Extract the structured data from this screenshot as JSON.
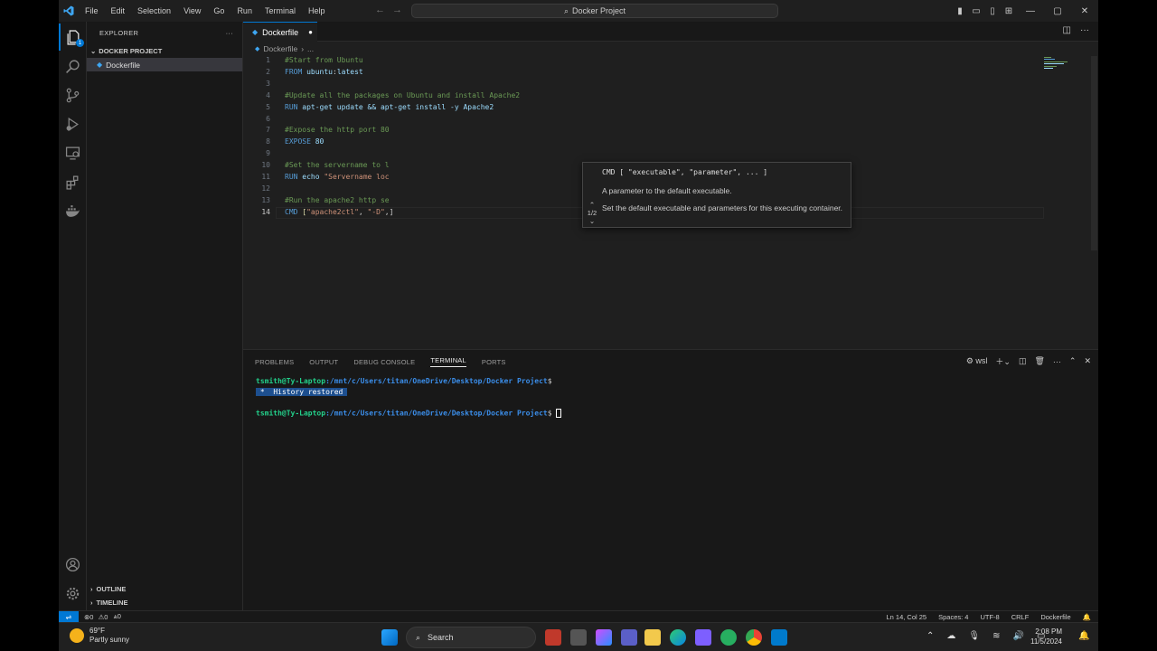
{
  "menu": [
    "File",
    "Edit",
    "Selection",
    "View",
    "Go",
    "Run",
    "Terminal",
    "Help"
  ],
  "command_center": "Docker Project",
  "sidebar": {
    "header": "EXPLORER",
    "project": "DOCKER PROJECT",
    "file": "Dockerfile",
    "outline": "OUTLINE",
    "timeline": "TIMELINE"
  },
  "editor": {
    "tab": "Dockerfile",
    "breadcrumb_file": "Dockerfile",
    "breadcrumb_more": "...",
    "lines": [
      {
        "n": "1",
        "parts": [
          {
            "c": "cm",
            "t": "#Start from Ubuntu"
          }
        ]
      },
      {
        "n": "2",
        "parts": [
          {
            "c": "kw",
            "t": "FROM "
          },
          {
            "c": "var",
            "t": "ubuntu"
          },
          {
            "c": "",
            "t": ":"
          },
          {
            "c": "var",
            "t": "latest"
          }
        ]
      },
      {
        "n": "3",
        "parts": []
      },
      {
        "n": "4",
        "parts": [
          {
            "c": "cm",
            "t": "#Update all the packages on Ubuntu and install Apache2"
          }
        ]
      },
      {
        "n": "5",
        "parts": [
          {
            "c": "kw",
            "t": "RUN "
          },
          {
            "c": "var",
            "t": "apt-get update && apt-get install -y Apache2"
          }
        ]
      },
      {
        "n": "6",
        "parts": []
      },
      {
        "n": "7",
        "parts": [
          {
            "c": "cm",
            "t": "#Expose the http port 80"
          }
        ]
      },
      {
        "n": "8",
        "parts": [
          {
            "c": "kw",
            "t": "EXPOSE "
          },
          {
            "c": "var",
            "t": "80"
          }
        ]
      },
      {
        "n": "9",
        "parts": []
      },
      {
        "n": "10",
        "parts": [
          {
            "c": "cm",
            "t": "#Set the servername to l"
          }
        ]
      },
      {
        "n": "11",
        "parts": [
          {
            "c": "kw",
            "t": "RUN "
          },
          {
            "c": "var",
            "t": "echo "
          },
          {
            "c": "str",
            "t": "\"Servername loc"
          }
        ]
      },
      {
        "n": "12",
        "parts": []
      },
      {
        "n": "13",
        "parts": [
          {
            "c": "cm",
            "t": "#Run the apache2 http se"
          }
        ]
      },
      {
        "n": "14",
        "parts": [
          {
            "c": "kw",
            "t": "CMD "
          },
          {
            "c": "fn",
            "t": "["
          },
          {
            "c": "str",
            "t": "\"apache2ctl\""
          },
          {
            "c": "",
            "t": ", "
          },
          {
            "c": "str",
            "t": "\"-D\""
          },
          {
            "c": "",
            "t": ",]"
          }
        ]
      }
    ]
  },
  "hover": {
    "signature": "CMD [ \"executable\", \"parameter\", ... ]",
    "param_doc": "A parameter to the default executable.",
    "description": "Set the default executable and parameters for this executing container.",
    "nav": "1/2"
  },
  "panel": {
    "tabs": [
      "PROBLEMS",
      "OUTPUT",
      "DEBUG CONSOLE",
      "TERMINAL",
      "PORTS"
    ],
    "active_tab": "TERMINAL",
    "shell": "wsl",
    "prompt_user": "tsmith@Ty-Laptop",
    "prompt_path": ":/mnt/c/Users/titan/OneDrive/Desktop/Docker Project",
    "prompt_end": "$",
    "history": "History restored",
    "history_marker": "*"
  },
  "status": {
    "errors": "0",
    "warnings": "0",
    "ports": "0",
    "position": "Ln 14, Col 25",
    "spaces": "Spaces: 4",
    "encoding": "UTF-8",
    "eol": "CRLF",
    "language": "Dockerfile"
  },
  "taskbar": {
    "temp": "69°F",
    "weather": "Partly sunny",
    "search": "Search",
    "time": "2:08 PM",
    "date": "11/5/2024"
  }
}
